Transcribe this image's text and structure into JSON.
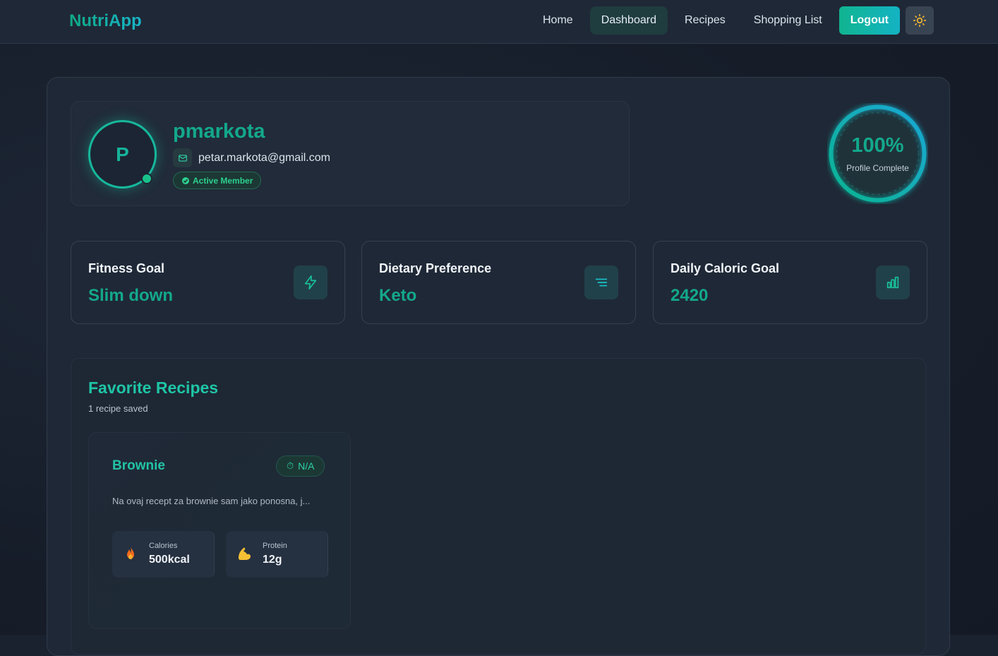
{
  "app": {
    "brand": "NutriApp"
  },
  "nav": {
    "links": [
      {
        "label": "Home",
        "active": false
      },
      {
        "label": "Dashboard",
        "active": true
      },
      {
        "label": "Recipes",
        "active": false
      },
      {
        "label": "Shopping List",
        "active": false
      }
    ],
    "logout_label": "Logout",
    "theme_toggle_icon": "sun-icon"
  },
  "profile": {
    "avatar_initial": "P",
    "username": "pmarkota",
    "email": "petar.markota@gmail.com",
    "status_badge": "Active Member",
    "completion_percent": 100,
    "completion_text": "100%",
    "completion_label": "Profile Complete"
  },
  "stats": [
    {
      "title": "Fitness Goal",
      "value": "Slim down",
      "icon": "lightning-icon"
    },
    {
      "title": "Dietary Preference",
      "value": "Keto",
      "icon": "lines-icon"
    },
    {
      "title": "Daily Caloric Goal",
      "value": "2420",
      "icon": "bar-chart-icon"
    }
  ],
  "favorites": {
    "title": "Favorite Recipes",
    "count_text": "1 recipe saved",
    "recipes": [
      {
        "name": "Brownie",
        "time": "N/A",
        "description": "Na ovaj recept za brownie sam jako ponosna, j...",
        "calories_label": "Calories",
        "calories_value": "500kcal",
        "protein_label": "Protein",
        "protein_value": "12g"
      }
    ]
  },
  "colors": {
    "accent": "#13a88c",
    "accent_cyan": "#14b3c4",
    "background": "#1f2836"
  }
}
